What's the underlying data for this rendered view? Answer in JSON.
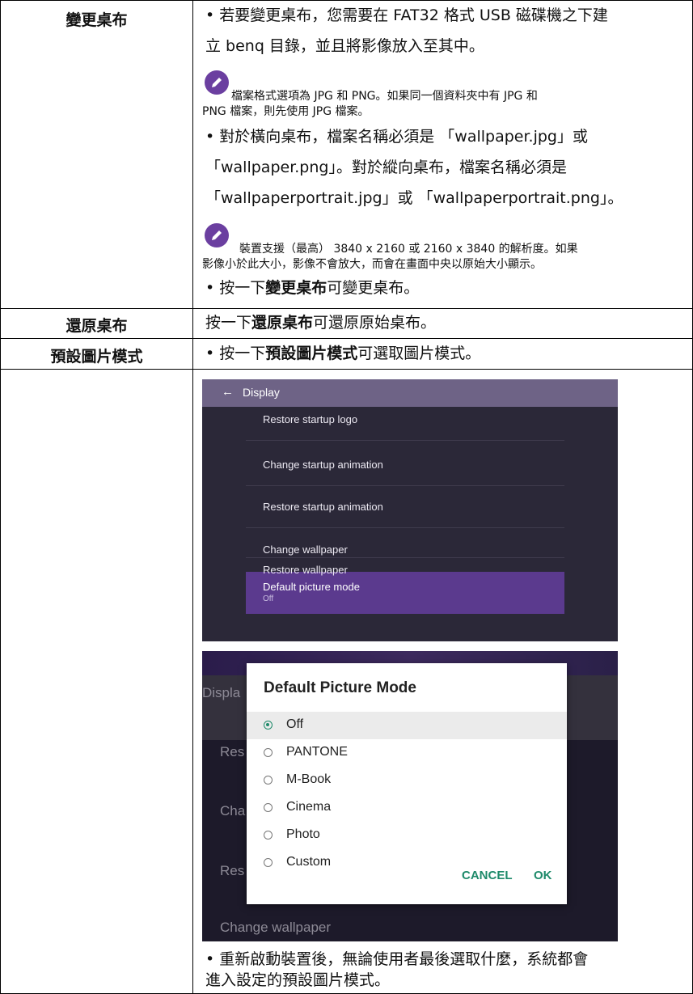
{
  "rows": [
    {
      "label": "變更桌布",
      "lines": [
        {
          "pre": "• 若要變更桌布，您需要在 FAT32 格式 USB 磁碟機之下建"
        },
        {
          "pre": "  立 benq 目錄，並且將影像放入至其中。"
        }
      ],
      "note1": [
        "檔案格式選項為 JPG 和 PNG。如果同一個資料夾中有 JPG 和",
        "PNG 檔案，則先使用 JPG 檔案。"
      ],
      "lines2": [
        "• 對於橫向桌布，檔案名稱必須是 「wallpaper.jpg」或",
        "  「wallpaper.png」。對於縱向桌布，檔案名稱必須是",
        "  「wallpaperportrait.jpg」或 「wallpaperportrait.png」。"
      ],
      "note2": [
        "裝置支援（最高） 3840 x 2160 或 2160 x 3840 的解析度。如果",
        "影像小於此大小，影像不會放大，而會在畫面中央以原始大小顯示。"
      ],
      "last": {
        "pre": "• 按一下",
        "bold": "變更桌布",
        "post": "可變更桌布。"
      }
    },
    {
      "label": "還原桌布",
      "text": {
        "pre": "按一下",
        "bold": "還原桌布",
        "post": "可還原原始桌布。"
      }
    },
    {
      "label": "預設圖片模式",
      "first": {
        "pre": "• 按一下",
        "bold": "預設圖片模式",
        "post": "可選取圖片模式。"
      },
      "last": [
        "• 重新啟動裝置後，無論使用者最後選取什麼，系統都會",
        "  進入設定的預設圖片模式。"
      ]
    }
  ],
  "screen1": {
    "title": "Display",
    "items": [
      "Restore startup logo",
      "Change startup animation",
      "Restore startup animation",
      "Change wallpaper",
      "Restore wallpaper"
    ],
    "selected_title": "Default picture mode",
    "selected_value": "Off"
  },
  "screen2": {
    "background_items": [
      "Displa",
      "Res",
      "Cha",
      "Res",
      "Change wallpaper"
    ],
    "dialog_title": "Default Picture Mode",
    "options": [
      "Off",
      "PANTONE",
      "M-Book",
      "Cinema",
      "Photo",
      "Custom"
    ],
    "selected": "Off",
    "cancel": "CANCEL",
    "ok": "OK"
  },
  "colors": {
    "accent": "#1e8a6a",
    "pencil": "#6b3fa0",
    "selected_item": "#5b3a8e"
  }
}
